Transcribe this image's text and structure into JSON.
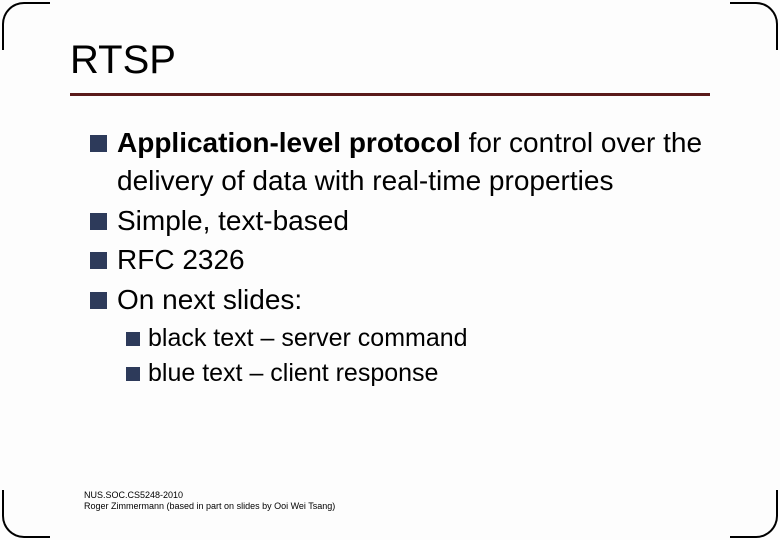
{
  "title": "RTSP",
  "bullets": {
    "b1_bold": "Application-level protocol",
    "b1_rest": " for control over the delivery of data with real-time properties",
    "b2": "Simple, text-based",
    "b3": "RFC 2326",
    "b4": "On next slides:",
    "s1": "black text – server command",
    "s2": "blue text – client response"
  },
  "footer": {
    "line1": "NUS.SOC.CS5248-2010",
    "line2": "Roger Zimmermann (based in part on slides by Ooi Wei Tsang)"
  }
}
